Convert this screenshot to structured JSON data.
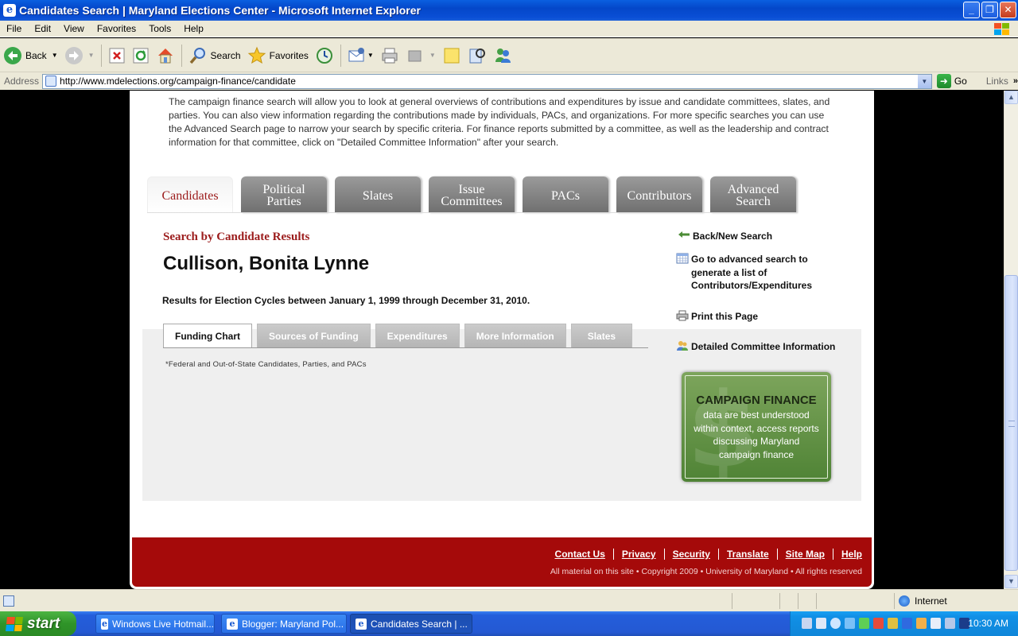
{
  "window": {
    "title": "Candidates Search | Maryland Elections Center - Microsoft Internet Explorer",
    "min_glyph": "_",
    "max_glyph": "❐",
    "close_glyph": "✕"
  },
  "menu": [
    "File",
    "Edit",
    "View",
    "Favorites",
    "Tools",
    "Help"
  ],
  "toolbar": {
    "back": "Back",
    "search": "Search",
    "favorites": "Favorites"
  },
  "address": {
    "label": "Address",
    "url": "http://www.mdelections.org/campaign-finance/candidate",
    "go": "Go",
    "links": "Links"
  },
  "page": {
    "intro": "The campaign finance search will allow you to look at general overviews of contributions and expenditures by issue and candidate committees, slates, and parties. You can also view information regarding the contributions made by individuals, PACs, and organizations. For more specific searches you can use the Advanced Search page to narrow your search by specific criteria. For finance reports submitted by a committee, as well as the leadership and contract information for that committee, click on \"Detailed Committee Information\" after your search.",
    "main_tabs": [
      {
        "label": "Candidates",
        "active": true
      },
      {
        "label": "Political Parties",
        "active": false
      },
      {
        "label": "Slates",
        "active": false
      },
      {
        "label": "Issue Committees",
        "active": false
      },
      {
        "label": "PACs",
        "active": false
      },
      {
        "label": "Contributors",
        "active": false
      },
      {
        "label": "Advanced Search",
        "active": false
      }
    ],
    "results_heading": "Search by Candidate Results",
    "candidate_name": "Cullison, Bonita Lynne",
    "cycles_text": "Results for Election Cycles between January 1, 1999 through December 31, 2010.",
    "sub_tabs": [
      {
        "label": "Funding Chart",
        "active": true
      },
      {
        "label": "Sources of Funding",
        "active": false
      },
      {
        "label": "Expenditures",
        "active": false
      },
      {
        "label": "More Information",
        "active": false
      },
      {
        "label": "Slates",
        "active": false
      }
    ],
    "footnote": "*Federal and Out-of-State Candidates, Parties, and PACs",
    "side_links": {
      "back_new_search": "Back/New Search",
      "advanced": "Go to advanced search to generate a list of Contributors/Expenditures",
      "print": "Print this Page",
      "detailed": "Detailed Committee Information"
    },
    "cf_box": {
      "title": "CAMPAIGN FINANCE",
      "body": "data are best understood within context, access reports discussing Maryland campaign finance",
      "watermark": "$"
    },
    "footer": {
      "links": [
        "Contact Us",
        "Privacy",
        "Security",
        "Translate",
        "Site Map",
        "Help"
      ],
      "copyright": "All material on this site • Copyright 2009 • University of Maryland • All rights reserved"
    }
  },
  "status": {
    "zone": "Internet"
  },
  "taskbar": {
    "start": "start",
    "tasks": [
      {
        "label": "Windows Live Hotmail...",
        "active": false
      },
      {
        "label": "Blogger: Maryland Pol...",
        "active": false
      },
      {
        "label": "Candidates Search | ...",
        "active": true
      }
    ],
    "clock": "10:30 AM"
  }
}
